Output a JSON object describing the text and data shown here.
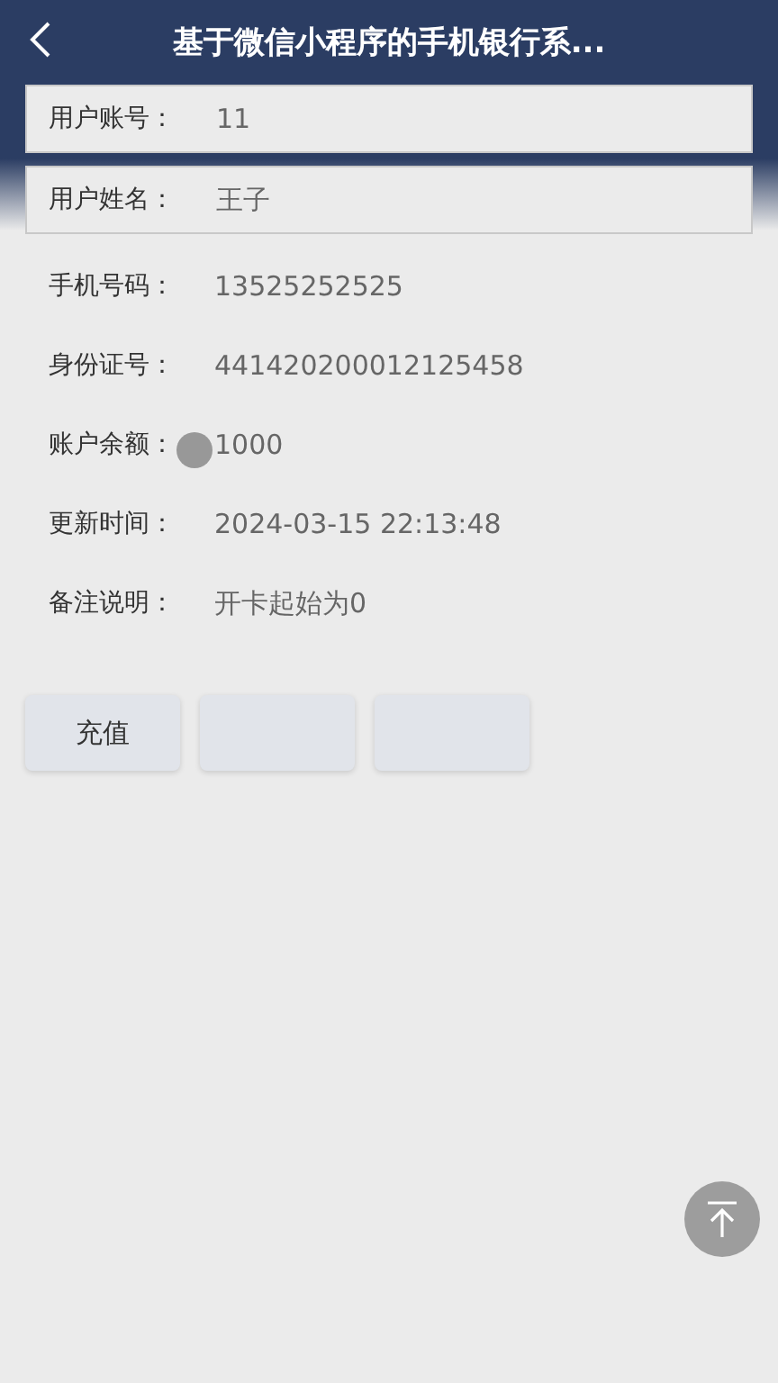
{
  "header": {
    "title": "基于微信小程序的手机银行系..."
  },
  "fields": [
    {
      "label": "用户账号：",
      "value": "11",
      "kind": "card"
    },
    {
      "label": "用户姓名：",
      "value": "王子",
      "kind": "card"
    },
    {
      "label": "手机号码：",
      "value": "13525252525",
      "kind": "plain"
    },
    {
      "label": "身份证号：",
      "value": "441420200012125458",
      "kind": "plain"
    },
    {
      "label": "账户余额：",
      "value": "1000",
      "kind": "plain"
    },
    {
      "label": "更新时间：",
      "value": "2024-03-15 22:13:48",
      "kind": "plain"
    },
    {
      "label": "备注说明：",
      "value": "开卡起始为0",
      "kind": "plain"
    }
  ],
  "buttons": [
    {
      "kind": "labeled",
      "label": "充值"
    },
    {
      "kind": "covered"
    },
    {
      "kind": "covered"
    }
  ],
  "touch_indicator": true
}
